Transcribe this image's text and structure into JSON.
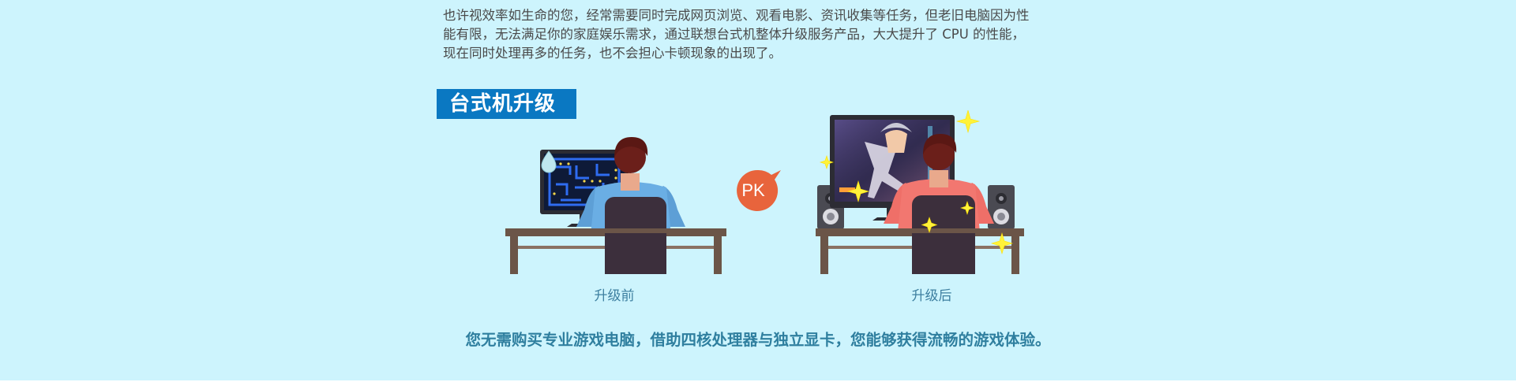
{
  "intro": {
    "lines": [
      "也许视效率如生命的您，经常需要同时完成网页浏览、观看电影、资讯收集等任务，但老旧电脑因为性",
      "能有限，无法满足你的家庭娱乐需求，通过联想台式机整体升级服务产品，大大提升了 CPU 的性能，",
      "现在同时处理再多的任务，也不会担心卡顿现象的出现了。"
    ]
  },
  "section": {
    "title": "台式机升级"
  },
  "comparison": {
    "before_caption": "升级前",
    "after_caption": "升级后",
    "pk_label": "PK"
  },
  "summary": "您无需购买专业游戏电脑，借助四核处理器与独立显卡，您能够获得流畅的游戏体验。",
  "colors": {
    "background": "#cdf4fd",
    "title_bar": "#0a78c2",
    "caption": "#3d7fa0",
    "summary": "#2f7f9f",
    "pk_badge": "#e8643c",
    "desk": "#6b5548",
    "chair": "#3c2f3c",
    "shirt_before": "#6aaee4",
    "shirt_after": "#f27770"
  }
}
